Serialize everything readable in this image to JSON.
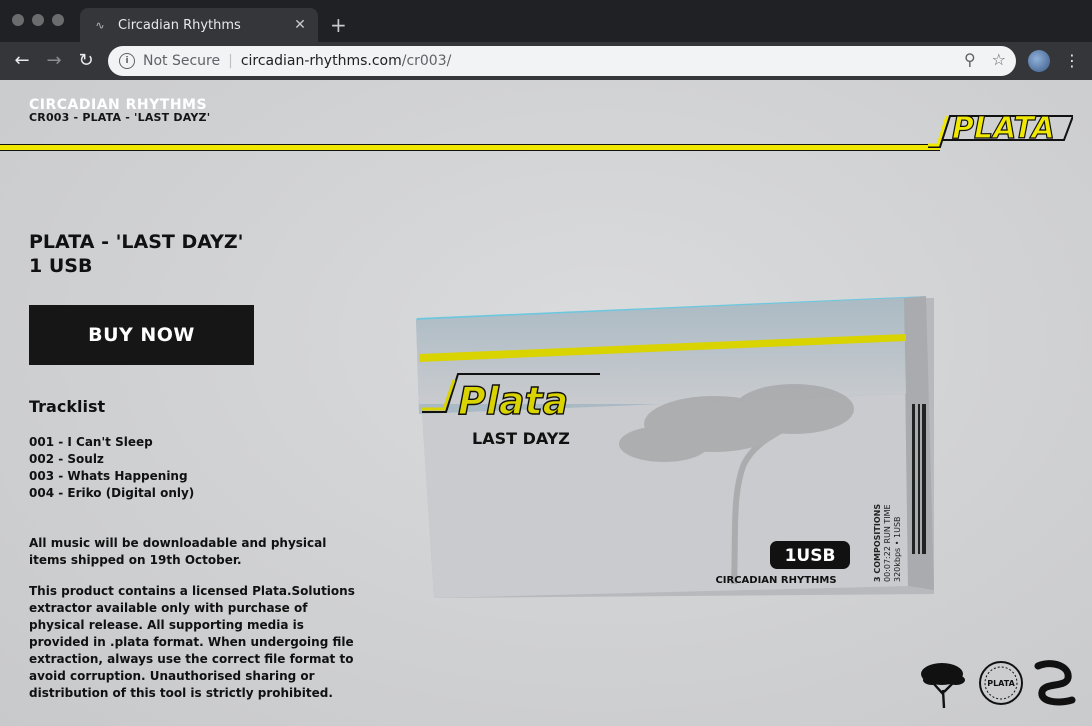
{
  "browser": {
    "tab_title": "Circadian Rhythms",
    "security_label": "Not Secure",
    "url_host": "circadian-rhythms.com",
    "url_path": "/cr003/"
  },
  "site": {
    "brand_name": "CIRCADIAN RHYTHMS",
    "brand_subtitle": "CR003 - PLATA - 'LAST DAYZ'",
    "logo_text": "PLATA",
    "accent_color": "#f0e800"
  },
  "product": {
    "title_line1": "PLATA - 'LAST DAYZ'",
    "title_line2": "1 USB",
    "buy_label": "BUY NOW"
  },
  "tracklist": {
    "heading": "Tracklist",
    "items": [
      "001 - I Can't Sleep",
      "002 - Soulz",
      "003 - Whats Happening",
      "004 - Eriko (Digital only)"
    ]
  },
  "notes": {
    "shipping": "All music will be downloadable and physical items shipped on 19th October.",
    "license": "This product contains a licensed Plata.Solutions extractor available only with purchase of physical release. All supporting media is provided in .plata format. When undergoing file extraction, always use the correct file format to avoid corruption. Unauthorised sharing or distribution of this tool is strictly prohibited."
  },
  "box_art": {
    "logo": "Plata",
    "subtitle": "LAST DAYZ",
    "badge": "1USB",
    "label": "CIRCADIAN RHYTHMS",
    "side_line1": "3  COMPOSITIONS",
    "side_line2": "00:07:22 RUN TIME",
    "side_line3": "320kbps • 1USB"
  },
  "footer_logos": {
    "seal_text": "PLATA"
  }
}
